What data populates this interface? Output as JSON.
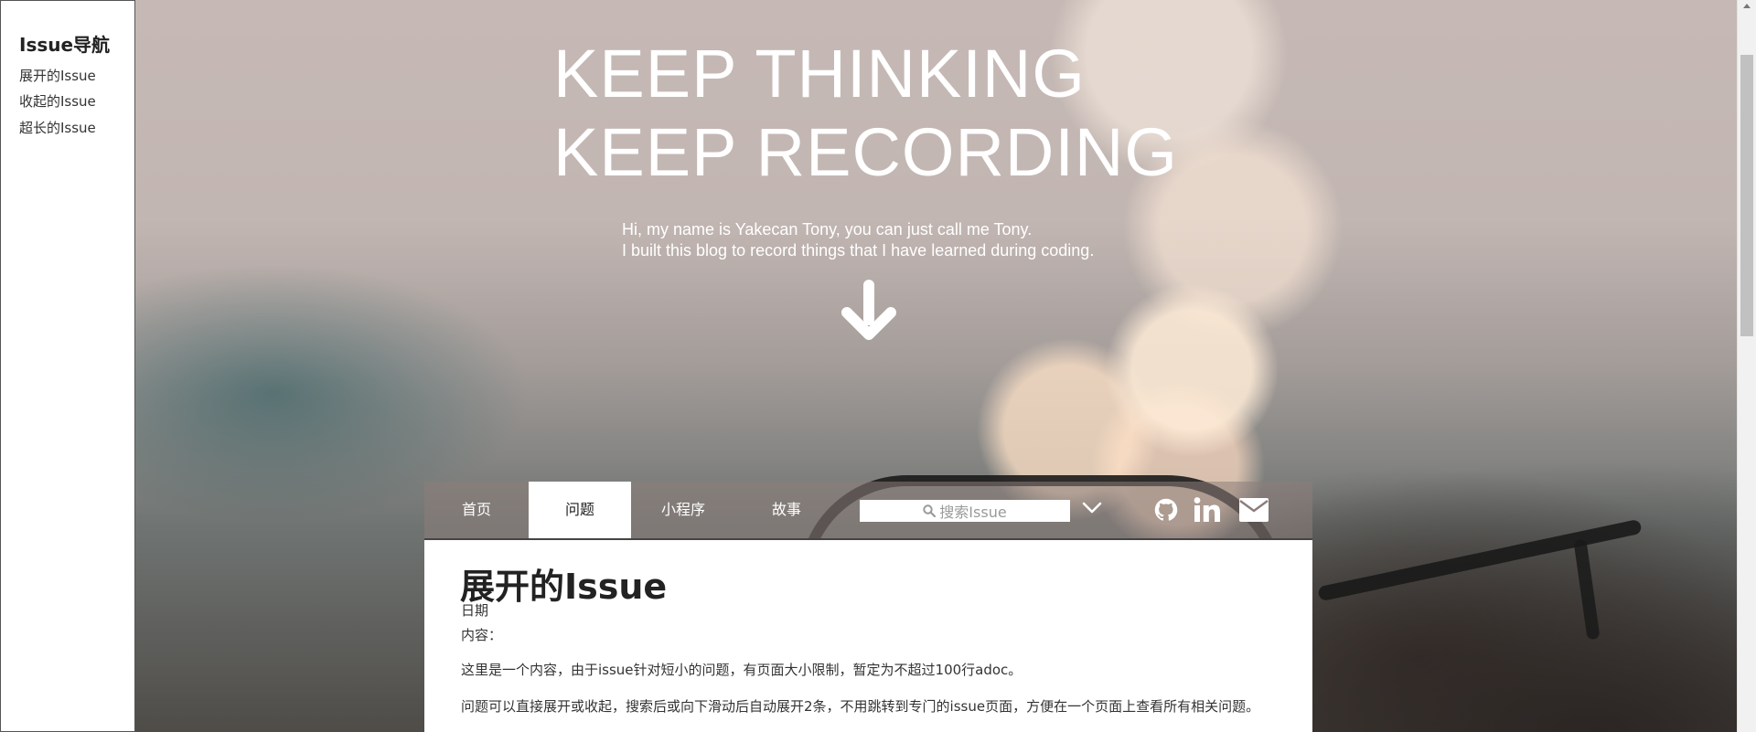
{
  "sidebar": {
    "title": "Issue导航",
    "items": [
      {
        "label": "展开的Issue"
      },
      {
        "label": "收起的Issue"
      },
      {
        "label": "超长的Issue"
      }
    ]
  },
  "hero": {
    "title_line1": "KEEP THINKING",
    "title_line2": "KEEP RECORDING",
    "subtitle_line1": "Hi, my name is Yakecan Tony, you can just call me Tony.",
    "subtitle_line2": "I built this blog to record things that I have learned during coding.",
    "arrow_icon": "arrow-down-icon"
  },
  "nav": {
    "tabs": [
      {
        "label": "首页",
        "active": false
      },
      {
        "label": "问题",
        "active": true
      },
      {
        "label": "小程序",
        "active": false
      },
      {
        "label": "故事",
        "active": false
      }
    ],
    "search_placeholder": "搜索Issue",
    "icons": [
      "search-icon",
      "chevron-down-icon",
      "github-icon",
      "linkedin-icon",
      "mail-icon"
    ]
  },
  "content": {
    "title": "展开的Issue",
    "date_label": "日期",
    "content_label": "内容：",
    "paragraph1": "这里是一个内容，由于issue针对短小的问题，有页面大小限制，暂定为不超过100行adoc。",
    "paragraph2": "问题可以直接展开或收起，搜索后或向下滑动后自动展开2条，不用跳转到专门的issue页面，方便在一个页面上查看所有相关问题。"
  },
  "colors": {
    "accent_white": "#ffffff",
    "text_dark": "#222222",
    "nav_bg": "#8c7d7a"
  }
}
